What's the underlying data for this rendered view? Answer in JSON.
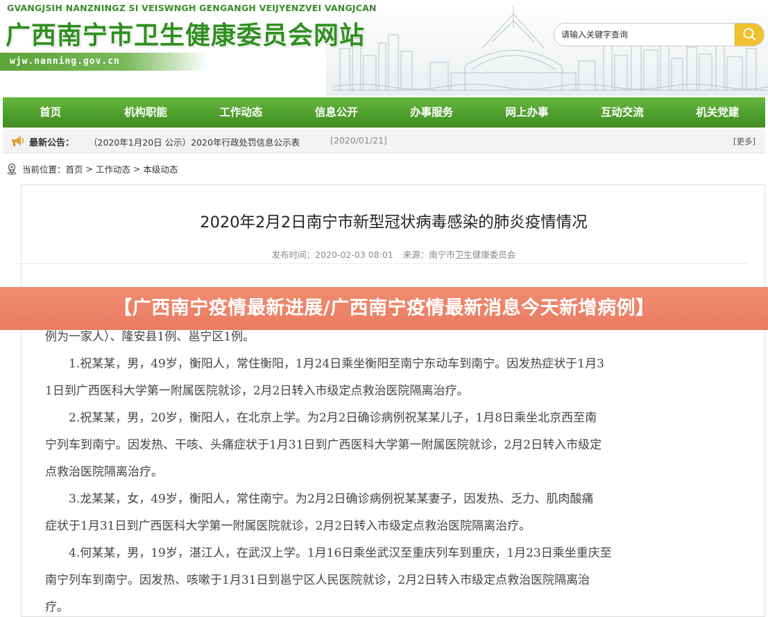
{
  "header": {
    "pinyin": "GVANGJSIH NANZNINGZ SI VEISWNGH GENGANGH VEIJYENZVEI VANGJCAN",
    "site_title": "广西南宁市卫生健康委员会网站",
    "site_url": "wjw.nanning.gov.cn"
  },
  "search": {
    "placeholder": "请输入关键字查询",
    "button_icon": "search-icon"
  },
  "nav": {
    "items": [
      "首页",
      "机构职能",
      "工作动态",
      "信息公开",
      "办事服务",
      "网上办事",
      "互动交流",
      "机关党建"
    ]
  },
  "notice": {
    "label": "最新公告：",
    "title": "（2020年1月20日 公示）2020年行政处罚信息公示表",
    "date": "[2020/01/21]",
    "more": "[更多]"
  },
  "breadcrumb": {
    "prefix": "当前位置：",
    "home": "首页",
    "sep": " > ",
    "section": "工作动态",
    "current": "本级动态"
  },
  "article": {
    "title": "2020年2月2日南宁市新型冠状病毒感染的肺炎疫情情况",
    "publish_time": "发布时间：2020-02-03 08:01",
    "source": "来源：南宁市卫生健康委员会",
    "lines": [
      "例为一家人）、隆安县1例、邕宁区1例。",
      "　　1.祝某某，男，49岁，衡阳人，常住衡阳，1月24日乘坐衡阳至南宁东动车到南宁。因发热症状于1月3",
      "1日到广西医科大学第一附属医院就诊，2月2日转入市级定点救治医院隔离治疗。",
      "　　2.祝某某，男，20岁，衡阳人，在北京上学。为2月2日确诊病例祝某某儿子，1月8日乘坐北京西至南",
      "宁列车到南宁。因发热、干咳、头痛症状于1月31日到广西医科大学第一附属医院就诊，2月2日转入市级定",
      "点救治医院隔离治疗。",
      "　　3.龙某某，女，49岁，衡阳人，常住南宁。为2月2日确诊病例祝某某妻子，因发热、乏力、肌肉酸痛",
      "症状于1月31日到广西医科大学第一附属医院就诊，2月2日转入市级定点救治医院隔离治疗。",
      "　　4.何某某，男，19岁，湛江人，在武汉上学。1月16日乘坐武汉至重庆列车到重庆，1月23日乘坐重庆至",
      "南宁列车到南宁。因发热、咳嗽于1月31日到邕宁区人民医院就诊，2月2日转入市级定点救治医院隔离治",
      "疗。"
    ]
  },
  "banner": {
    "text": "【广西南宁疫情最新进展/广西南宁疫情最新消息今天新增病例】"
  },
  "colors": {
    "nav_green": "#4f9f2d",
    "title_green": "#2f8f1f",
    "search_yellow": "#f2c12e",
    "banner": "#e97a5c"
  }
}
